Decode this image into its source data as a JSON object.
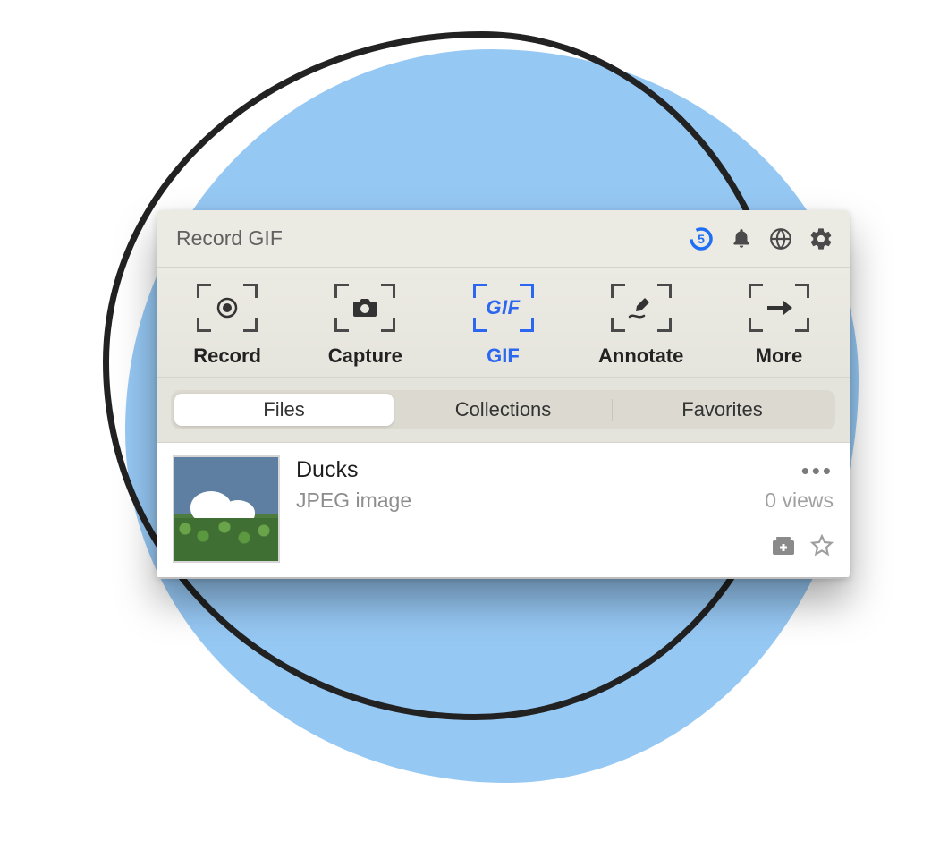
{
  "header": {
    "title": "Record GIF",
    "countdown": "5"
  },
  "toolbar": {
    "items": [
      {
        "label": "Record",
        "active": false
      },
      {
        "label": "Capture",
        "active": false
      },
      {
        "label": "GIF",
        "active": true,
        "iconText": "GIF"
      },
      {
        "label": "Annotate",
        "active": false
      },
      {
        "label": "More",
        "active": false
      }
    ]
  },
  "tabs": {
    "items": [
      {
        "label": "Files",
        "active": true
      },
      {
        "label": "Collections",
        "active": false
      },
      {
        "label": "Favorites",
        "active": false
      }
    ]
  },
  "list": {
    "items": [
      {
        "title": "Ducks",
        "subtitle": "JPEG image",
        "views": "0 views"
      }
    ]
  }
}
